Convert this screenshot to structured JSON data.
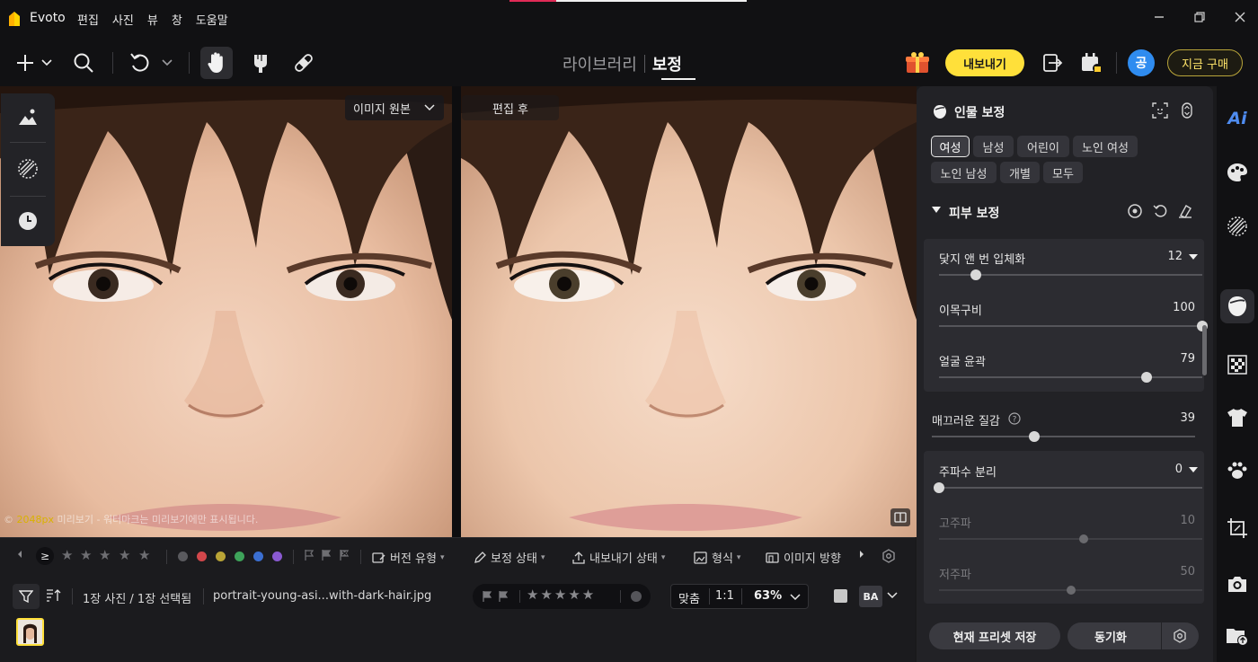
{
  "app": {
    "name": "Evoto"
  },
  "menu": [
    "편집",
    "사진",
    "뷰",
    "창",
    "도움말"
  ],
  "window_controls": [
    "minimize-icon",
    "restore-icon",
    "close-icon"
  ],
  "toolbar": {
    "mode_tabs": [
      "라이브러리",
      "보정"
    ],
    "active_mode": "보정",
    "export_label": "내보내기",
    "avatar_text": "공",
    "buy_label": "지금 구매",
    "icons": [
      "add-icon",
      "chevron-down-icon",
      "search-icon",
      "undo-icon",
      "chevron-down-icon",
      "hand-icon",
      "brush-tool-icon",
      "bandage-icon",
      "gift-box-icon",
      "batch-export-icon",
      "calendar-gift-icon"
    ]
  },
  "canvas": {
    "original_select": "이미지 원본",
    "after_label": "편집 후",
    "preview_note_size": "2048px",
    "preview_note_text": " 미리보기 - 워터마크는 미리보기에만 표시됩니다."
  },
  "filterbar": {
    "compare_symbol": "≥",
    "stars": [
      "★",
      "★",
      "★",
      "★",
      "★"
    ],
    "color_labels": [
      "#5a5a5e",
      "#d2474b",
      "#b9a436",
      "#3ea35a",
      "#3b6fd1",
      "#8a5ad1"
    ],
    "version_type": "버전 유형",
    "edit_status": "보정 상태",
    "export_status": "내보내기 상태",
    "format": "형식",
    "orientation": "이미지 방향"
  },
  "statusbar": {
    "count_text": "1장 사진 / 1장 선택됨",
    "filename": "portrait-young-asi...with-dark-hair.jpg",
    "fit_label": "맞춤",
    "one_to_one": "1:1",
    "zoom": "63%",
    "ba_label": "BA"
  },
  "panel": {
    "title": "인물 보정",
    "presets": [
      "여성",
      "남성",
      "어린이",
      "노인 여성",
      "노인 남성",
      "개별",
      "모두"
    ],
    "active_preset": "여성",
    "section_title": "피부 보정",
    "sliders": [
      {
        "label": "닻지 앤 번 입체화",
        "value": "12",
        "fraction": 0.14,
        "dropdown": true
      },
      {
        "label": "이목구비",
        "value": "100",
        "fraction": 1.0
      },
      {
        "label": "얼굴 윤곽",
        "value": "79",
        "fraction": 0.79
      },
      {
        "label": "매끄러운 질감",
        "value": "39",
        "fraction": 0.39,
        "info": true
      },
      {
        "label": "주파수 분리",
        "value": "0",
        "fraction": 0.0,
        "dropdown": true
      },
      {
        "label": "고주파",
        "value": "10",
        "fraction": 0.55,
        "disabled": true
      },
      {
        "label": "저주파",
        "value": "50",
        "fraction": 0.5,
        "disabled": true
      }
    ],
    "save_preset": "현재 프리셋 저장",
    "sync": "동기화"
  },
  "rail": {
    "ai_label": "Ai",
    "icons": [
      "ai-icon",
      "palette-icon",
      "texture-icon",
      "portrait-retouch-icon",
      "checker-background-icon",
      "clothing-icon",
      "paw-icon",
      "crop-icon",
      "camera-icon",
      "folder-upload-icon"
    ]
  }
}
